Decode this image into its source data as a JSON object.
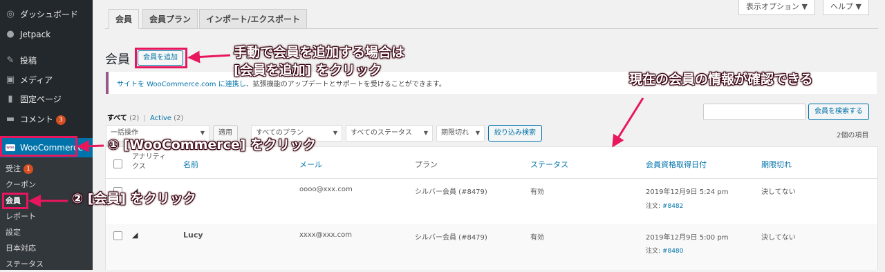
{
  "sidebar": {
    "items": [
      {
        "icon": "dashboard-icon",
        "glyph": "◎",
        "label": "ダッシュボード"
      },
      {
        "icon": "jetpack-icon",
        "glyph": "●",
        "label": "Jetpack"
      },
      {
        "icon": "pin-icon",
        "glyph": "✎",
        "label": "投稿"
      },
      {
        "icon": "media-icon",
        "glyph": "▣",
        "label": "メディア"
      },
      {
        "icon": "page-icon",
        "glyph": "▮",
        "label": "固定ページ"
      },
      {
        "icon": "comment-icon",
        "glyph": "▬",
        "label": "コメント",
        "badge": "3"
      },
      {
        "icon": "woo-icon",
        "glyph": "woo",
        "label": "WooCommerce"
      }
    ],
    "submenu": [
      {
        "label": "受注",
        "badge": "1"
      },
      {
        "label": "クーポン"
      },
      {
        "label": "会員"
      },
      {
        "label": "レポート"
      },
      {
        "label": "設定"
      },
      {
        "label": "日本対応"
      },
      {
        "label": "ステータス"
      }
    ]
  },
  "topbar": {
    "screen_options": "表示オプション ▼",
    "help": "ヘルプ ▼"
  },
  "tabs": [
    "会員",
    "会員プラン",
    "インポート/エクスポート"
  ],
  "page": {
    "title": "会員",
    "add_button": "会員を追加"
  },
  "notice": {
    "link": "サイトを WooCommerce.com に連携し",
    "text": "、拡張機能のアップデートとサポートを受けることができます。"
  },
  "filters": {
    "all_label": "すべて",
    "all_count": "(2)",
    "sep": "|",
    "active_label": "Active",
    "active_count": "(2)",
    "bulk": "一括操作",
    "apply": "適用",
    "plans": "すべてのプラン",
    "statuses": "すべてのステータス",
    "expiry": "期限切れ",
    "filter_btn": "絞り込み検索",
    "search_btn": "会員を検索する",
    "item_count": "2個の項目"
  },
  "table": {
    "headers": [
      "アナリティクス",
      "名前",
      "メール",
      "プラン",
      "ステータス",
      "会員資格取得日付",
      "期限切れ"
    ],
    "rows": [
      {
        "name": "",
        "email": "oooo@xxx.com",
        "plan": "シルバー会員 (#8479)",
        "status": "有効",
        "date": "2019年12月9日 5:24 pm",
        "order_label": "注文:",
        "order": "#8482",
        "expiry": "決してない"
      },
      {
        "name": "Lucy",
        "email": "xxxx@xxx.com",
        "plan": "シルバー会員 (#8479)",
        "status": "有効",
        "date": "2019年12月9日 5:00 pm",
        "order_label": "注文:",
        "order": "#8480",
        "expiry": "決してない"
      }
    ]
  },
  "annotations": {
    "add_line1": "手動で会員を追加する場合は",
    "add_line2": "[会員を追加] をクリック",
    "info": "現在の会員の情報が確認できる",
    "step1": "① [WooCommerce] をクリック",
    "step2": "② [会員] をクリック"
  },
  "colors": {
    "accent": "#0073aa",
    "highlight": "#e8175d",
    "sidebar": "#23282d"
  }
}
